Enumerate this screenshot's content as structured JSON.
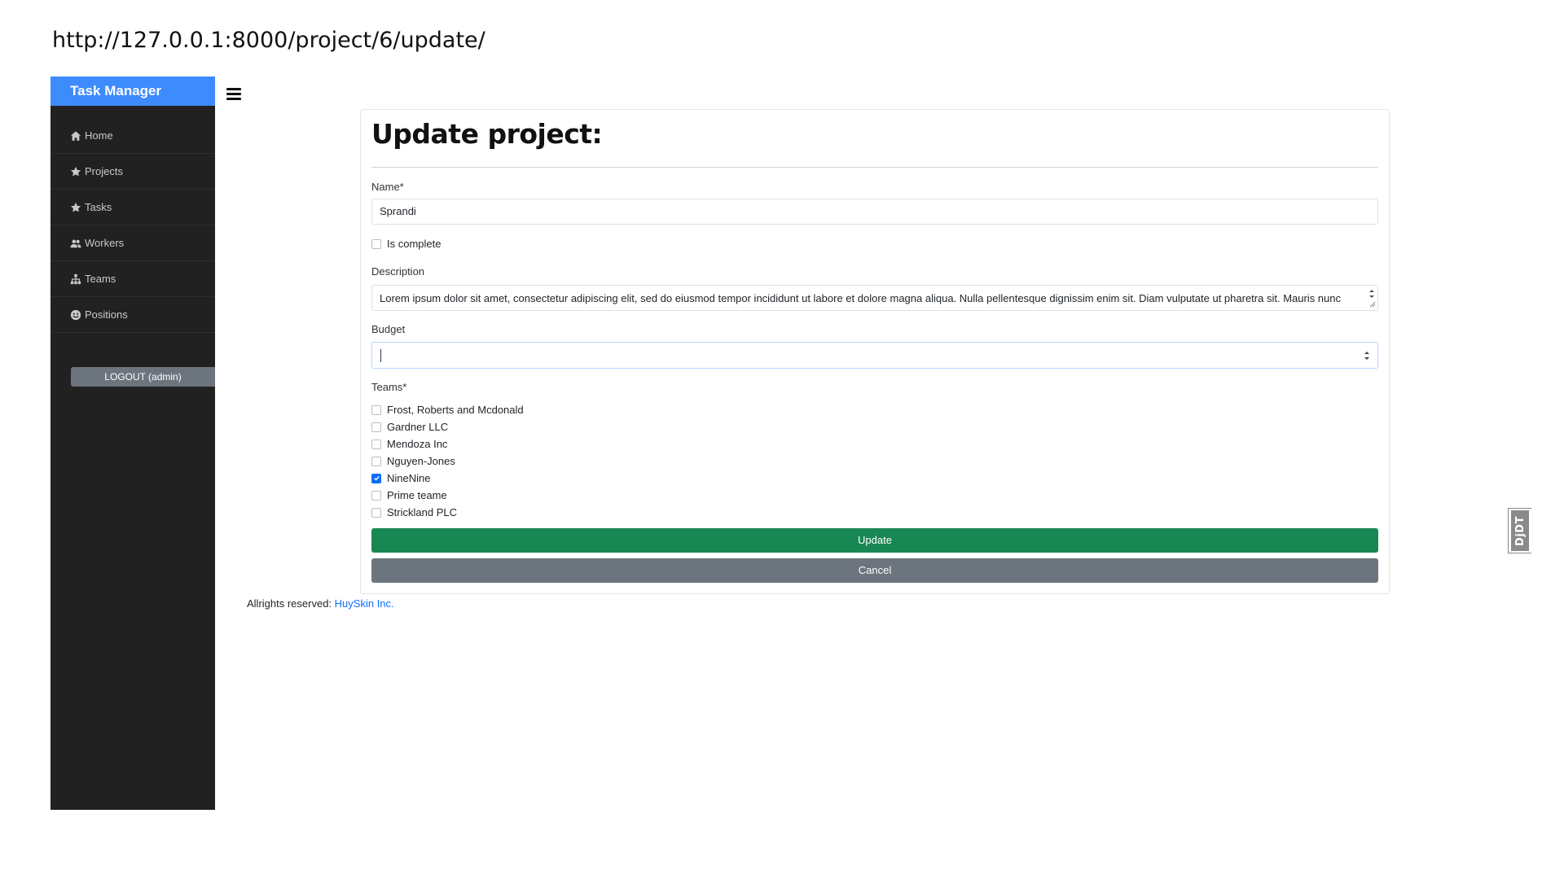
{
  "browser": {
    "url": "http://127.0.0.1:8000/project/6/update/"
  },
  "sidebar": {
    "brand": "Task Manager",
    "items": [
      {
        "label": "Home",
        "icon": "home-icon"
      },
      {
        "label": "Projects",
        "icon": "star-icon"
      },
      {
        "label": "Tasks",
        "icon": "star-icon"
      },
      {
        "label": "Workers",
        "icon": "users-icon"
      },
      {
        "label": "Teams",
        "icon": "sitemap-icon"
      },
      {
        "label": "Positions",
        "icon": "smile-icon"
      }
    ],
    "logout_label": "LOGOUT (admin)"
  },
  "form": {
    "title": "Update project:",
    "name_label": "Name*",
    "name_value": "Sprandi",
    "is_complete_label": "Is complete",
    "is_complete_checked": false,
    "description_label": "Description",
    "description_value": "Lorem ipsum dolor sit amet, consectetur adipiscing elit, sed do eiusmod tempor incididunt ut labore et dolore magna aliqua. Nulla pellentesque dignissim enim sit. Diam vulputate ut pharetra sit. Mauris nunc",
    "budget_label": "Budget",
    "budget_value": "",
    "teams_label": "Teams*",
    "teams": [
      {
        "label": "Frost, Roberts and Mcdonald",
        "checked": false
      },
      {
        "label": "Gardner LLC",
        "checked": false
      },
      {
        "label": "Mendoza Inc",
        "checked": false
      },
      {
        "label": "Nguyen-Jones",
        "checked": false
      },
      {
        "label": "NineNine",
        "checked": true
      },
      {
        "label": "Prime teame",
        "checked": false
      },
      {
        "label": "Strickland PLC",
        "checked": false
      }
    ],
    "update_label": "Update",
    "cancel_label": "Cancel"
  },
  "footer": {
    "prefix": "Allrights reserved:",
    "link_text": "HuySkin Inc."
  },
  "debug_toolbar": {
    "label": "DjDT"
  },
  "colors": {
    "brand_bg": "#3d8bfd",
    "sidebar_bg": "#212121",
    "update_bg": "#198754",
    "cancel_bg": "#6c757d",
    "checkbox_checked": "#0d6efd",
    "link": "#0d6efd"
  }
}
